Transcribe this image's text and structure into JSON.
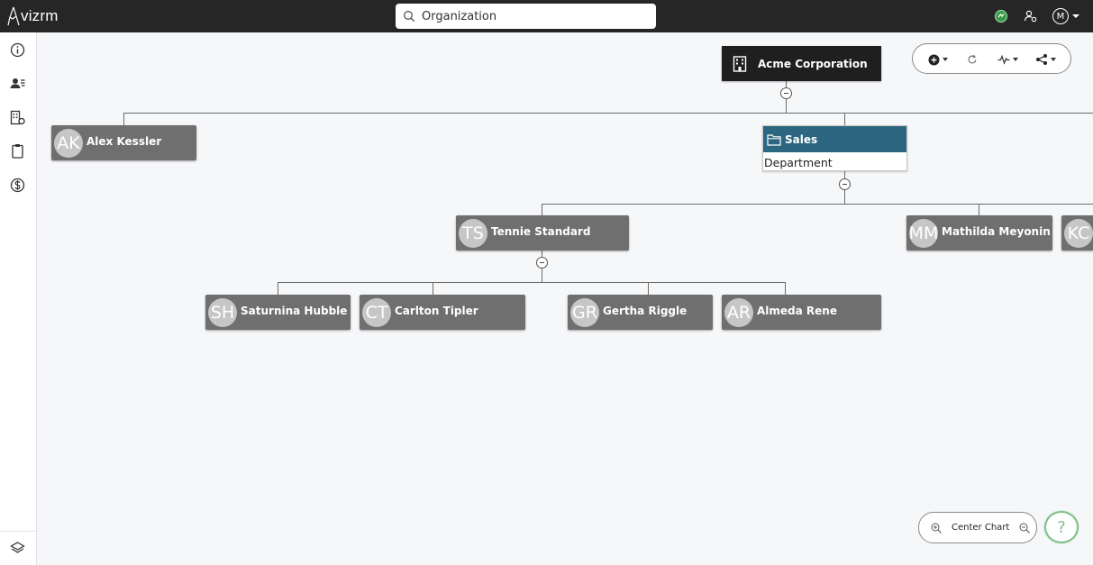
{
  "app": {
    "logo_text": "vizrm"
  },
  "search": {
    "value": "Organization",
    "placeholder": ""
  },
  "user": {
    "initial": "M"
  },
  "sidebar": {
    "items": [
      {
        "icon": "info-icon"
      },
      {
        "icon": "contacts-icon"
      },
      {
        "icon": "building-settings-icon"
      },
      {
        "icon": "clipboard-icon"
      },
      {
        "icon": "dollar-icon"
      }
    ],
    "bottom_icon": "layers-icon"
  },
  "chart": {
    "root": {
      "label": "Acme Corporation",
      "icon": "building-icon"
    },
    "department": {
      "name": "Sales",
      "type": "Department",
      "icon": "folder-icon",
      "color": "#2d6680"
    },
    "people": [
      {
        "initials": "AK",
        "name": "Alex Kessler"
      },
      {
        "initials": "TS",
        "name": "Tennie Standard"
      },
      {
        "initials": "MM",
        "name": "Mathilda Meyonin"
      },
      {
        "initials": "KC",
        "name": ""
      },
      {
        "initials": "SH",
        "name": "Saturnina Hubble"
      },
      {
        "initials": "CT",
        "name": "Carlton Tipler"
      },
      {
        "initials": "GR",
        "name": "Gertha Riggle"
      },
      {
        "initials": "AR",
        "name": "Almeda Rene"
      }
    ]
  },
  "toolbar": {
    "icons": [
      "add-circle-icon",
      "refresh-icon",
      "activity-icon",
      "share-icon"
    ]
  },
  "controls": {
    "center_chart_label": "Center Chart",
    "help_label": "?",
    "help_color": "#7ec08a"
  }
}
